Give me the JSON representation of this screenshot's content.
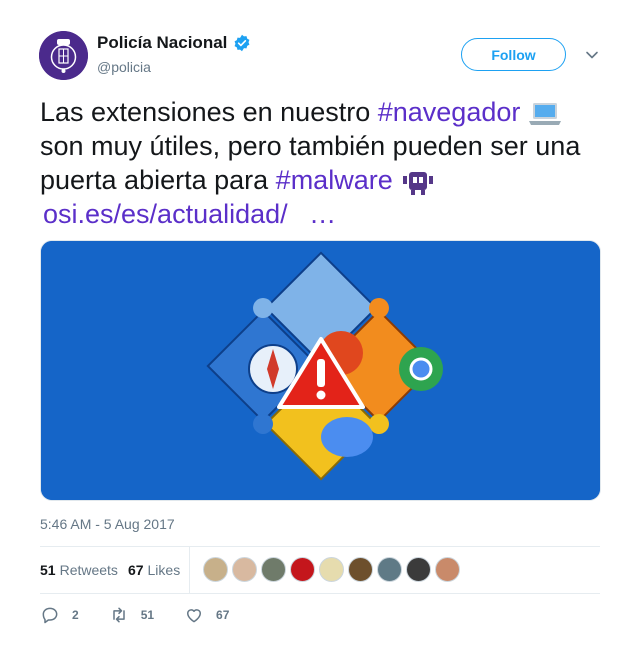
{
  "account": {
    "name": "Policía Nacional",
    "handle": "@policia",
    "verified": true,
    "avatar_icon": "police-crest-icon"
  },
  "follow_label": "Follow",
  "tweet": {
    "line1_text": "Las extensiones en nuestro ",
    "line1_tag": "#navegador",
    "line2_text": "son muy útiles, pero también pueden ser una",
    "line3_text": "puerta abierta para ",
    "line3_tag": "#malware",
    "link_text": "osi.es/es/actualidad/",
    "ellipsis": "…",
    "emoji_laptop": "laptop-icon",
    "emoji_alien": "alien-monster-icon"
  },
  "media": {
    "description_icon": "browser-puzzle-warning-image"
  },
  "timestamp": "5:46 AM - 5 Aug 2017",
  "stats": {
    "retweets_count": "51",
    "retweets_label": "Retweets",
    "likes_count": "67",
    "likes_label": "Likes"
  },
  "actions": {
    "reply_count": "2",
    "retweet_count": "51",
    "like_count": "67"
  },
  "colors": {
    "accent": "#1da1f2",
    "hashtag": "#5b2fc9",
    "secondary_text": "#657786",
    "media_bg": "#1565c8"
  }
}
